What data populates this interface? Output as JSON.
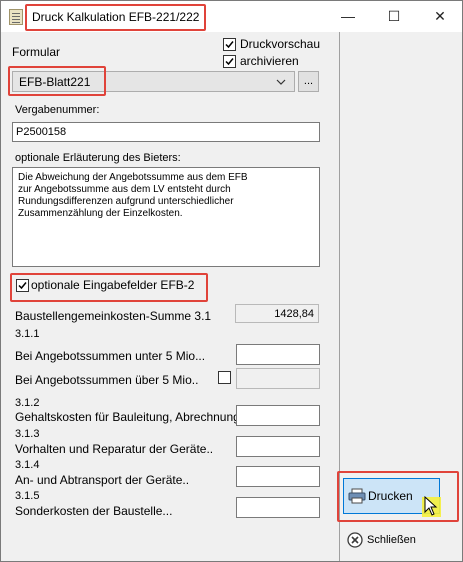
{
  "window": {
    "title": "Druck Kalkulation EFB-221/222",
    "minimize_glyph": "—",
    "maximize_glyph": "☐",
    "close_glyph": "✕"
  },
  "form": {
    "formular_label": "Formular",
    "druckvorschau_label": "Druckvorschau",
    "druckvorschau_checked": true,
    "archivieren_label": "archivieren",
    "archivieren_checked": true,
    "formular_value": "EFB-Blatt221",
    "browse_label": "...",
    "vergabenummer_label": "Vergabenummer:",
    "vergabenummer_value": "P2500158",
    "erlaeuterung_label": "optionale Erläuterung des Bieters:",
    "erlaeuterung_value": "Die Abweichung der Angebotssumme aus dem EFB zur Angebotssumme aus dem LV entsteht durch Rundungsdifferenzen aufgrund unterschiedlicher Zusammenzählung der Einzelkosten.",
    "optionale_label": "optionale  Eingabefelder  EFB-2",
    "optionale_checked": true,
    "baustellen_label": "Baustellengemeinkosten-Summe 3.1",
    "baustellen_value": "1428,84",
    "sec_311": "3.1.1",
    "unter_label": "Bei Angebotssummen unter 5 Mio...",
    "unter_value": "",
    "ueber_label": "Bei Angebotssummen über 5 Mio..",
    "ueber_checked": false,
    "ueber_value": "",
    "sec_312": "3.1.2",
    "gehalt_label": "Gehaltskosten für Bauleitung, Abrechnung,..",
    "gehalt_value": "",
    "sec_313": "3.1.3",
    "vorhalten_label": "Vorhalten und Reparatur der Geräte..",
    "vorhalten_value": "",
    "sec_314": "3.1.4",
    "an_ab_label": "An- und Abtransport der Geräte..",
    "an_ab_value": "",
    "sec_315": "3.1.5",
    "sonder_label": "Sonderkosten der Baustelle...",
    "sonder_value": ""
  },
  "actions": {
    "drucken_label": "Drucken",
    "schliessen_label": "Schließen"
  },
  "colors": {
    "highlight": "#e0433a",
    "drucken_bg": "#cce4f7",
    "drucken_border": "#0078d7",
    "cursor_glow": "#f5ef3b"
  },
  "icons": {
    "app": "form-icon",
    "printer": "printer-icon",
    "close_circle": "close-circle-icon",
    "cursor": "mouse-pointer-icon",
    "checkmark": "checkmark-icon",
    "dropdown": "chevron-down-icon"
  }
}
